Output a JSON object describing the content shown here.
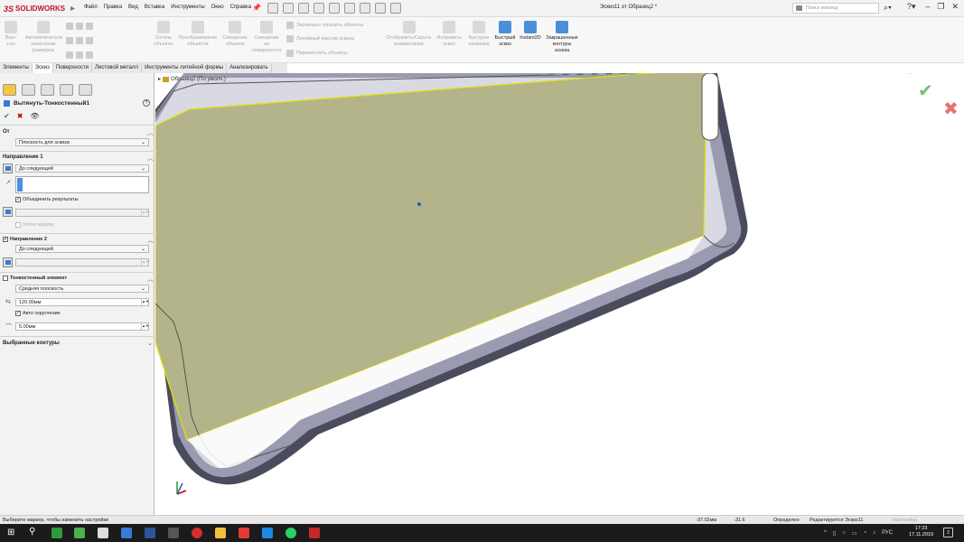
{
  "app": {
    "brand": "SOLIDWORKS",
    "brand_prefix": "3S",
    "doc_title": "Эскиз11 от Образец2 *"
  },
  "menus": [
    "Файл",
    "Правка",
    "Вид",
    "Вставка",
    "Инструменты",
    "Окно",
    "Справка"
  ],
  "search": {
    "placeholder": "Поиск команд"
  },
  "toolbar": {
    "sketch_group": [
      "Вые-\nз из",
      "Автоматическое\nнанесение\nразмеров"
    ],
    "g1": "Отсечь\nобъекты",
    "g2": "Преобразование\nобъектов",
    "g3": "Смещение\nобъекта",
    "g4": "Смещение\nна\nповерхности",
    "mirror": "Зеркально отразить объекты",
    "linear": "Линейный массив эскиза",
    "move": "Переместить объекты",
    "showhide": "Отобразить/Скрыть\nвзаимосвязи",
    "fix": "Исправить\nэскиз",
    "fast": "Быстрые\nпривязки",
    "quick": "Быстрый\nэскиз",
    "instant": "Instant2D",
    "shaded": "Закрашенные\nконтуры\nэскиза"
  },
  "tabs": [
    "Элементы",
    "Эскиз",
    "Поверхности",
    "Листовой металл",
    "Инструменты литейной формы",
    "Анализировать"
  ],
  "active_tab": "Эскиз",
  "property_manager": {
    "title": "Вытянуть-Тонкостенный1",
    "from_label": "От",
    "from_value": "Плоскость для эскиза",
    "dir1_label": "Направление 1",
    "dir1_value": "До следующей",
    "merge_label": "Объединить результаты",
    "draft_out_label": "Уклон наружу",
    "dir2_label": "Направление 2",
    "dir2_value": "До следующей",
    "thin_label": "Тонкостенный элемент",
    "thin_value": "Средняя плоскость",
    "thickness": "120.00мм",
    "auto_fillet_label": "Авто скругление",
    "fillet_radius": "5.00мм",
    "selected_contours_label": "Выбранные контуры"
  },
  "tree": {
    "label": "Образец2 (По умолч.)"
  },
  "status": {
    "hint": "Выберите маркер, чтобы изменить настройки",
    "x": "-37.02мм",
    "y": "-31.6",
    "defined": "Определен",
    "editing": "Редактируется Эскиз11",
    "units": "Настройка"
  },
  "taskbar": {
    "time": "17:23",
    "date": "17.11.2019",
    "lang": "РУС",
    "notif": "2"
  }
}
